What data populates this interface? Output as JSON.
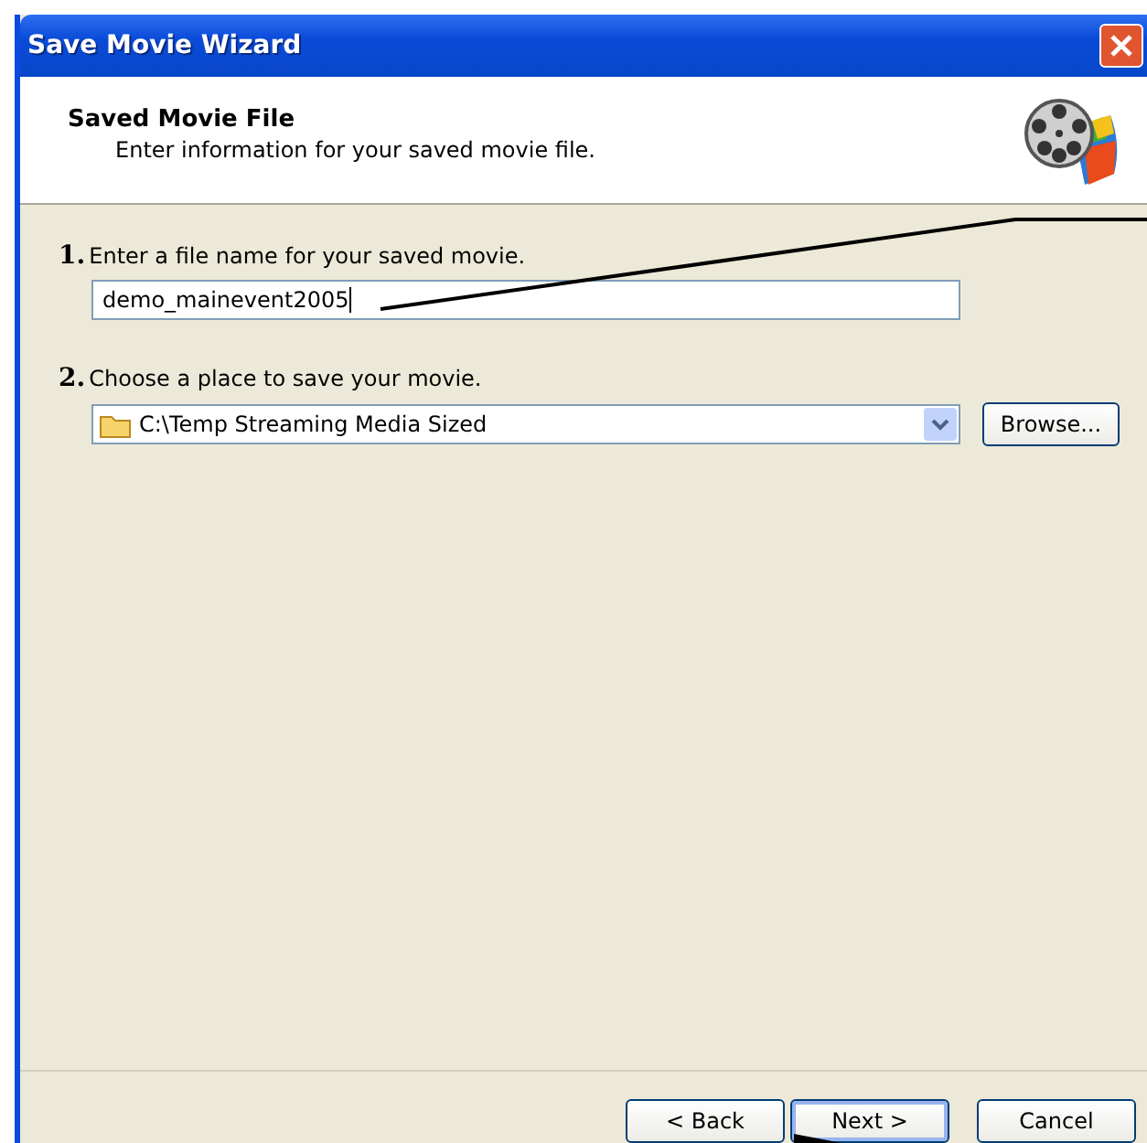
{
  "window": {
    "title": "Save Movie Wizard"
  },
  "header": {
    "title": "Saved Movie File",
    "subtitle": "Enter information for your saved movie file."
  },
  "steps": [
    {
      "number": "1.",
      "label": "Enter a file name for your saved movie.",
      "kind": "text",
      "value": "demo_mainevent2005"
    },
    {
      "number": "2.",
      "label": "Choose a place to save your movie.",
      "kind": "dropdown",
      "value": "C:\\Temp Streaming Media Sized",
      "button": "Browse..."
    }
  ],
  "buttons": [
    {
      "label": "< Back",
      "default": false
    },
    {
      "label": "Next >",
      "default": true
    },
    {
      "label": "Cancel",
      "default": false
    }
  ]
}
